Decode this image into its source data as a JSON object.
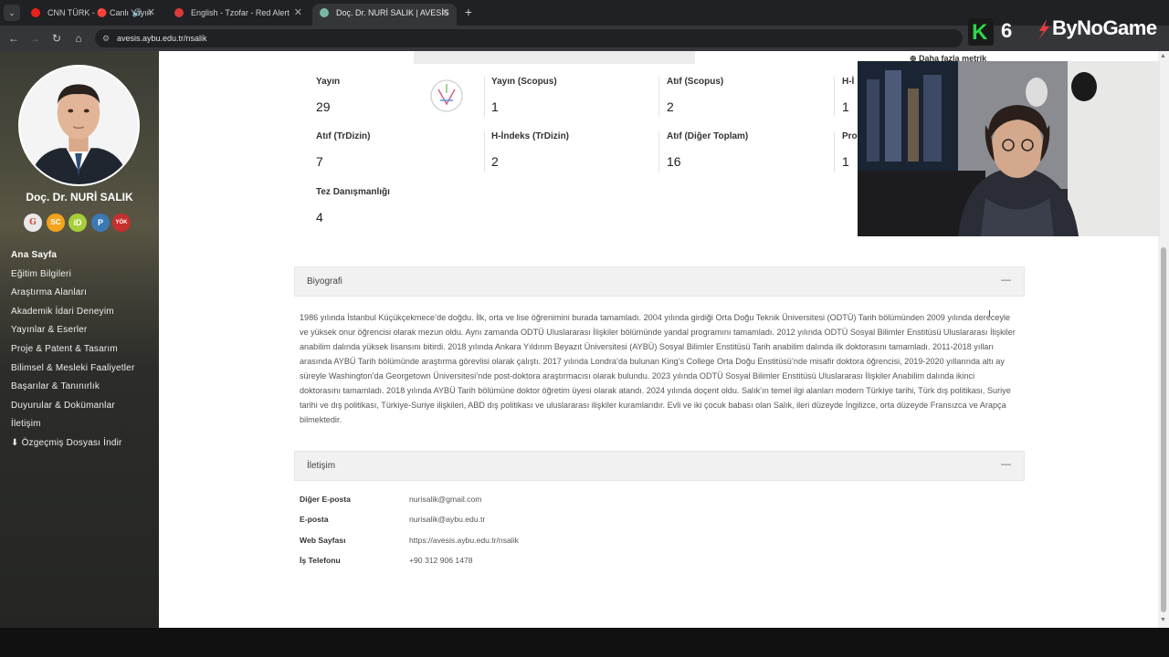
{
  "browser": {
    "tabs": [
      {
        "label": "CNN TÜRK - 🔴 Canlı Yayın",
        "icon": "youtube-icon",
        "active": false
      },
      {
        "label": "English - Tzofar - Red Alert",
        "icon": "red-alert-icon",
        "active": false
      },
      {
        "label": "Doç. Dr. NURİ SALIK | AVESİS",
        "icon": "avesis-icon",
        "active": true
      }
    ],
    "url": "avesis.aybu.edu.tr/nsalik"
  },
  "sidebar": {
    "name": "Doç. Dr. NURİ SALIK",
    "badges": [
      {
        "label": "G",
        "icon": "google-scholar-icon",
        "color": "#e9e9e9"
      },
      {
        "label": "SC",
        "icon": "scopus-icon",
        "color": "#f4a31c"
      },
      {
        "label": "iD",
        "icon": "orcid-icon",
        "color": "#a6ce39"
      },
      {
        "label": "P",
        "icon": "publons-icon",
        "color": "#3b78b4"
      },
      {
        "label": "YÖK",
        "icon": "yok-icon",
        "color": "#c62f2f"
      }
    ],
    "menu": [
      "Ana Sayfa",
      "Eğitim Bilgileri",
      "Araştırma Alanları",
      "Akademik İdari Deneyim",
      "Yayınlar & Eserler",
      "Proje & Patent & Tasarım",
      "Bilimsel & Mesleki Faaliyetler",
      "Başarılar & Tanınırlık",
      "Duyurular & Dokümanlar",
      "İletişim",
      "Özgeçmiş Dosyası İndir"
    ]
  },
  "metrics": {
    "more": "Daha fazla metrik",
    "items": [
      {
        "label": "Yayın",
        "value": "29"
      },
      {
        "label": "Yayın (Scopus)",
        "value": "1"
      },
      {
        "label": "Atıf (Scopus)",
        "value": "2"
      },
      {
        "label": "H-İ",
        "value": "1"
      },
      {
        "label": "Atıf (TrDizin)",
        "value": "7"
      },
      {
        "label": "H-İndeks (TrDizin)",
        "value": "2"
      },
      {
        "label": "Atıf (Diğer Toplam)",
        "value": "16"
      },
      {
        "label": "Pro",
        "value": "1"
      },
      {
        "label": "Tez Danışmanlığı",
        "value": "4"
      }
    ]
  },
  "biography": {
    "title": "Biyografi",
    "toggle": "—",
    "text": "1986 yılında İstanbul Küçükçekmece’de doğdu. İlk, orta ve lise öğrenimini burada tamamladı. 2004 yılında girdiği Orta Doğu Teknik Üniversitesi (ODTÜ) Tarih bölümünden 2009 yılında dereceyle ve yüksek onur öğrencisi olarak mezun oldu. Aynı zamanda ODTÜ Uluslararası İlişkiler bölümünde yandal programını tamamladı. 2012 yılında ODTÜ Sosyal Bilimler Enstitüsü Uluslararası İlişkiler anabilim dalında yüksek lisansını bitirdi. 2018 yılında Ankara Yıldırım Beyazıt Üniversitesi (AYBÜ) Sosyal Bilimler Enstitüsü Tarih anabilim dalında ilk doktorasını tamamladı. 2011-2018 yılları arasında AYBÜ Tarih bölümünde araştırma görevlisi olarak çalıştı. 2017 yılında Londra’da bulunan King’s College Orta Doğu Enstitüsü’nde misafir doktora öğrencisi, 2019-2020 yıllarında altı ay süreyle Washington’da Georgetown Üniversitesi’nde post-doktora araştırmacısı olarak bulundu. 2023 yılında ODTÜ Sosyal Bilimler Enstitüsü Uluslararası İlişkiler Anabilim dalında ikinci doktorasını tamamladı. 2018 yılında AYBÜ Tarih bölümüne doktor öğretim üyesi olarak atandı. 2024 yılında doçent oldu. Salık’ın temel ilgi alanları modern Türkiye tarihi, Türk dış politikası, Suriye tarihi ve dış politikası, Türkiye-Suriye ilişkileri, ABD dış politikası ve uluslararası ilişkiler kuramlarıdır. Evli ve iki çocuk babası olan Salık, ileri düzeyde İngilizce, orta düzeyde Fransızca ve Arapça bilmektedir."
  },
  "contact": {
    "title": "İletişim",
    "toggle": "—",
    "rows": [
      {
        "label": "Diğer E-posta",
        "value": "nurisalik@gmail.com"
      },
      {
        "label": "E-posta",
        "value": "nurisalik@aybu.edu.tr"
      },
      {
        "label": "Web Sayfası",
        "value": "https://avesis.aybu.edu.tr/nsalik"
      },
      {
        "label": "İş Telefonu",
        "value": "+90 312 906 1478"
      }
    ]
  },
  "overlay": {
    "counter_letter": "K",
    "counter_value": "6",
    "brand": "ByNoGame"
  }
}
